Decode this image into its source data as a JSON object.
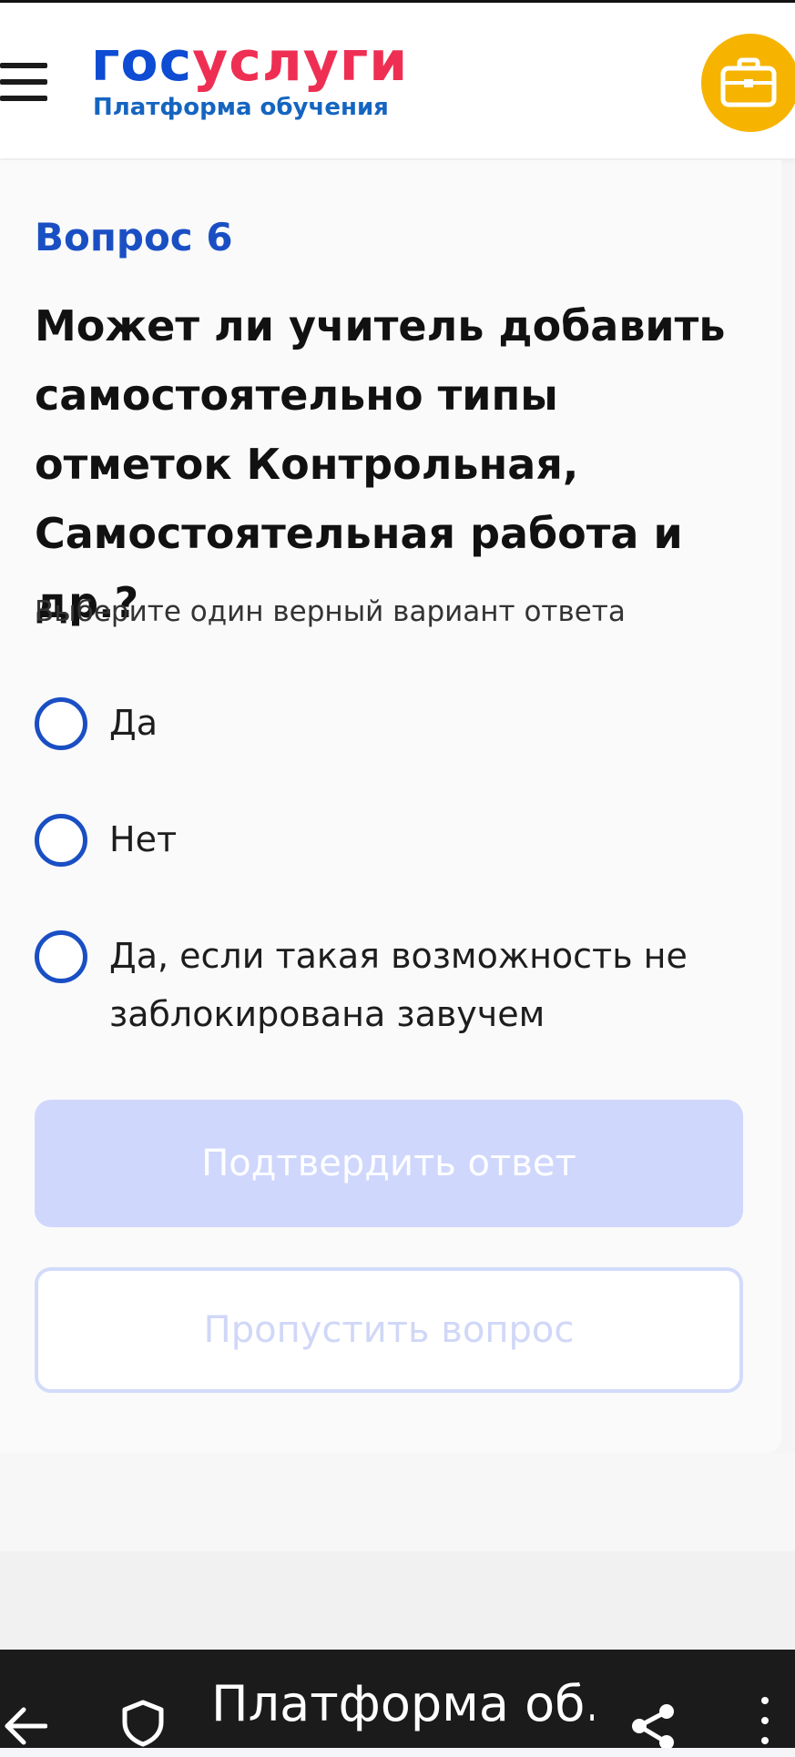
{
  "header": {
    "logo_part1": "гос",
    "logo_part2": "услуги",
    "logo_subtitle": "Платформа обучения"
  },
  "question": {
    "number_label": "Вопрос 6",
    "text": "Может ли учитель добавить самостоятельно типы отметок Контрольная, Самостоятельная работа и др.?",
    "instruction": "Выберите один верный вариант ответа",
    "options": [
      {
        "label": "Да"
      },
      {
        "label": "Нет"
      },
      {
        "label": "Да, если такая возможность не заблокирована завучем"
      }
    ]
  },
  "actions": {
    "confirm_label": "Подтвердить ответ",
    "skip_label": "Пропустить вопрос"
  },
  "browser": {
    "tab_title": "Платформа об..."
  },
  "colors": {
    "brand_blue": "#0d4cd3",
    "brand_red": "#ee2f53",
    "accent_yellow": "#f6b400",
    "radio_blue": "#1a4fc4",
    "disabled_button": "#cfd7fd"
  },
  "icons": [
    "hamburger-menu-icon",
    "briefcase-icon",
    "back-arrow-icon",
    "shield-icon",
    "share-icon",
    "more-vertical-icon"
  ]
}
